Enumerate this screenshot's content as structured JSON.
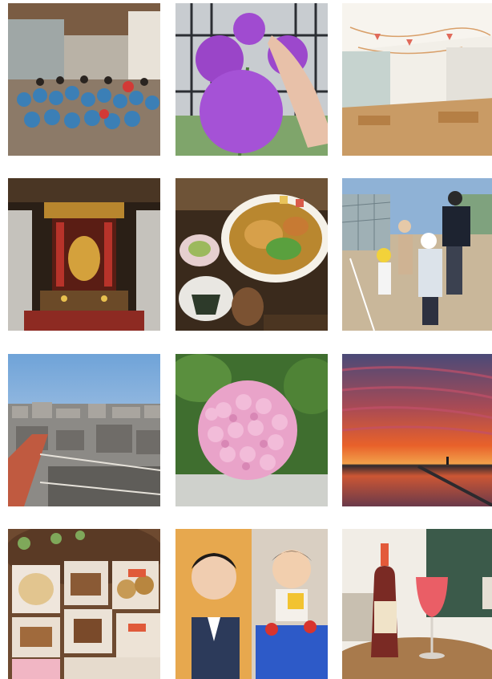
{
  "gallery": {
    "photos": [
      {
        "subject": "group-photo-kids-team"
      },
      {
        "subject": "purple-allium-flowers"
      },
      {
        "subject": "wooden-floor-hall-with-bunting"
      },
      {
        "subject": "buddhist-altar"
      },
      {
        "subject": "udon-bowl-with-onigiri"
      },
      {
        "subject": "kids-on-school-rooftop"
      },
      {
        "subject": "city-skyline-morning"
      },
      {
        "subject": "pink-hydrangea"
      },
      {
        "subject": "sunset-over-flooded-field"
      },
      {
        "subject": "assorted-baked-sweets"
      },
      {
        "subject": "man-portrait-and-figurine-cake"
      },
      {
        "subject": "red-drink-bottle-and-glass"
      }
    ],
    "colors": {
      "background": "#ffffff",
      "sunset_orange": "#e8612a",
      "hydrangea_pink": "#e9a3c9",
      "allium_purple": "#a04bd0"
    }
  }
}
